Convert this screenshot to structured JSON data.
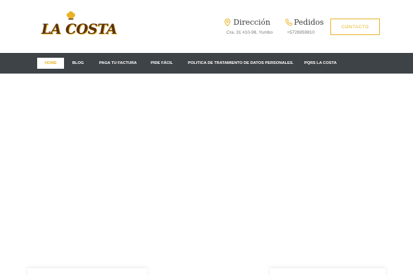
{
  "brand": {
    "logo_text": "LA COSTA",
    "color_brown": "#5a3311",
    "color_gold": "#e9b224"
  },
  "header": {
    "direccion": {
      "title": "Dirección",
      "value": "Cra. 31 #10-98, Yumbo",
      "icon": "location-pin-icon"
    },
    "pedidos": {
      "title": "Pedidos",
      "value": "+5726959810",
      "icon": "phone-icon"
    },
    "contact_label": "CONTACTO"
  },
  "nav": {
    "items": [
      {
        "label": "HOME",
        "active": true
      },
      {
        "label": "BLOG"
      },
      {
        "label": "PAGA TU FACTURA"
      },
      {
        "label": "PIDE FÁCIL"
      },
      {
        "label": "POLITICA DE TRATAMIENTO DE DATOS PERSONALES."
      },
      {
        "label": "PQRS LA COSTA"
      }
    ],
    "background": "#3e4347"
  }
}
